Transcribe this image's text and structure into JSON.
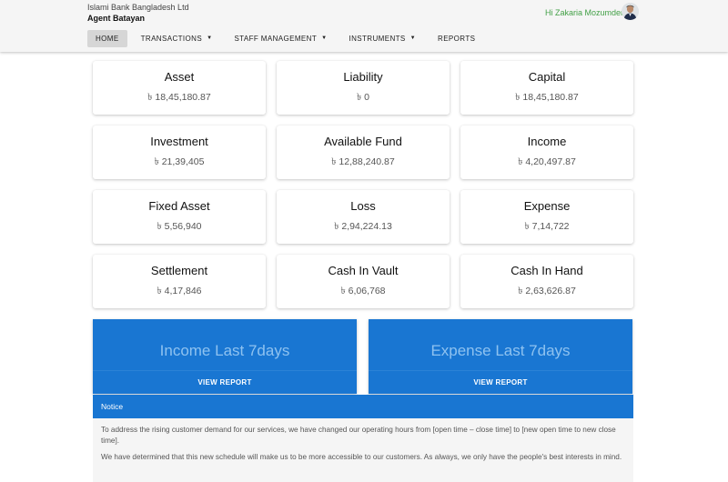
{
  "header": {
    "org_name": "Islami Bank Bangladesh Ltd",
    "agent_name": "Agent Batayan",
    "greeting": "Hi Zakaria Mozumder"
  },
  "nav": {
    "home": "HOME",
    "transactions": "TRANSACTIONS",
    "staff_management": "STAFF MANAGEMENT",
    "instruments": "INSTRUMENTS",
    "reports": "REPORTS",
    "caret": "▼"
  },
  "cards": [
    {
      "title": "Asset",
      "value": "৳ 18,45,180.87"
    },
    {
      "title": "Liability",
      "value": "৳ 0"
    },
    {
      "title": "Capital",
      "value": "৳ 18,45,180.87"
    },
    {
      "title": "Investment",
      "value": "৳ 21,39,405"
    },
    {
      "title": "Available Fund",
      "value": "৳ 12,88,240.87"
    },
    {
      "title": "Income",
      "value": "৳ 4,20,497.87"
    },
    {
      "title": "Fixed Asset",
      "value": "৳ 5,56,940"
    },
    {
      "title": "Loss",
      "value": "৳ 2,94,224.13"
    },
    {
      "title": "Expense",
      "value": "৳ 7,14,722"
    },
    {
      "title": "Settlement",
      "value": "৳ 4,17,846"
    },
    {
      "title": "Cash In Vault",
      "value": "৳ 6,06,768"
    },
    {
      "title": "Cash In Hand",
      "value": "৳ 2,63,626.87"
    }
  ],
  "reports": {
    "income_title": "Income Last 7days",
    "expense_title": "Expense Last 7days",
    "view_label": "VIEW REPORT"
  },
  "notice": {
    "title": "Notice",
    "paragraph1": "To address the rising customer demand for our services, we have changed our operating hours from [open time – close time] to [new open time to new close time].",
    "paragraph2": "We have determined that this new schedule will make us to be more accessible to our customers. As always, we only have the people's best interests in mind."
  },
  "colors": {
    "primary": "#1976d2",
    "greeting": "#43a047"
  }
}
